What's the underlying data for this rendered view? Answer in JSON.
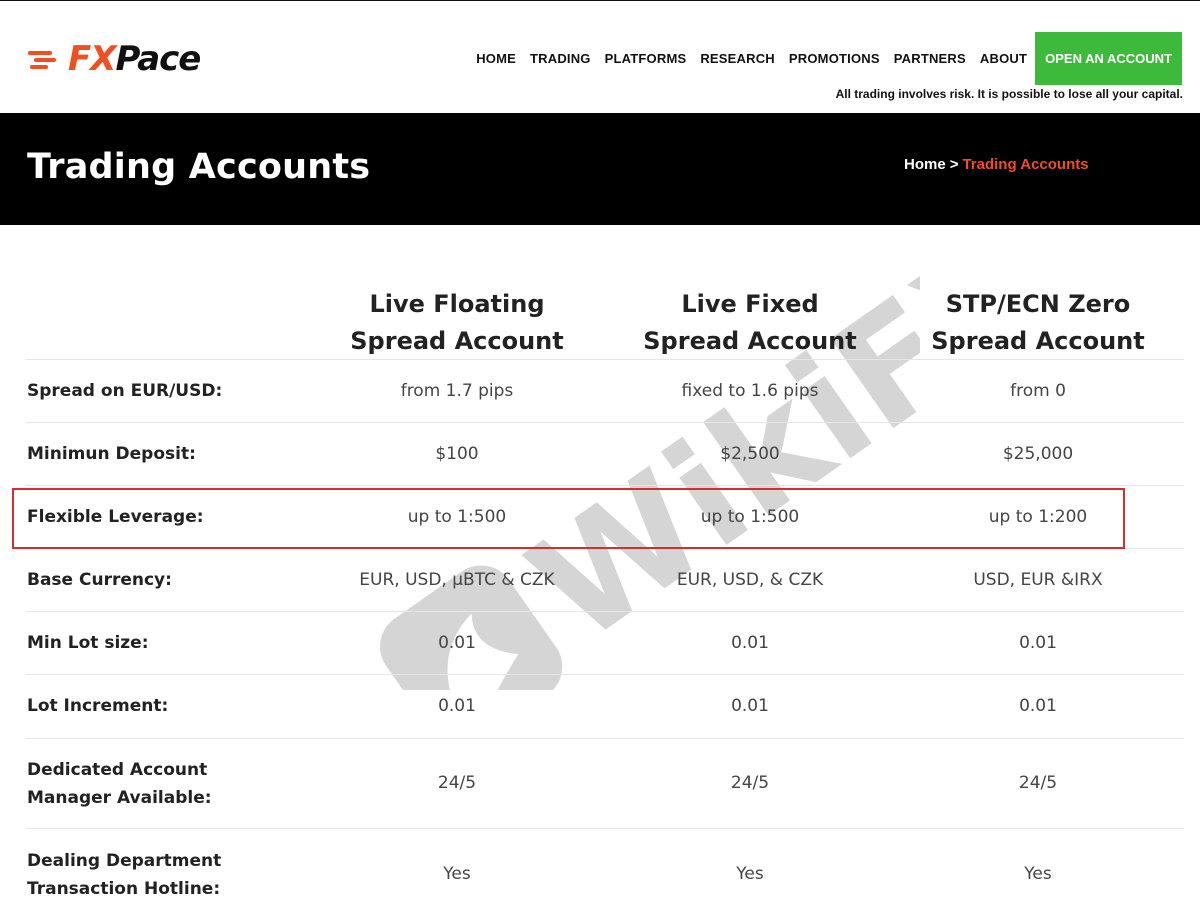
{
  "brand": {
    "logo_fx": "FX",
    "logo_pace": "Pace",
    "accent": "#f04e23",
    "cta_color": "#3dba3b"
  },
  "nav": {
    "items": [
      "HOME",
      "TRADING",
      "PLATFORMS",
      "RESEARCH",
      "PROMOTIONS",
      "PARTNERS",
      "ABOUT"
    ],
    "cta": "OPEN AN ACCOUNT",
    "risk_notice": "All trading involves risk. It is possible to lose all your capital."
  },
  "page": {
    "title": "Trading Accounts",
    "breadcrumb_home": "Home",
    "breadcrumb_sep": ">",
    "breadcrumb_current": "Trading Accounts"
  },
  "table": {
    "columns": [
      [
        "Live Floating",
        "Spread Account"
      ],
      [
        "Live Fixed",
        "Spread Account"
      ],
      [
        "STP/ECN Zero",
        "Spread Account"
      ]
    ],
    "rows": [
      {
        "label": [
          "Spread on EUR/USD:"
        ],
        "values": [
          "from 1.7 pips",
          "fixed to 1.6 pips",
          "from 0"
        ]
      },
      {
        "label": [
          "Minimun Deposit:"
        ],
        "values": [
          "$100",
          "$2,500",
          "$25,000"
        ]
      },
      {
        "label": [
          "Flexible Leverage:"
        ],
        "values": [
          "up to 1:500",
          "up to 1:500",
          "up to 1:200"
        ]
      },
      {
        "label": [
          "Base Currency:"
        ],
        "values": [
          "EUR, USD, µBTC & CZK",
          "EUR, USD, & CZK",
          "USD, EUR &IRX"
        ]
      },
      {
        "label": [
          "Min Lot size:"
        ],
        "values": [
          "0.01",
          "0.01",
          "0.01"
        ]
      },
      {
        "label": [
          "Lot Increment:"
        ],
        "values": [
          "0.01",
          "0.01",
          "0.01"
        ]
      },
      {
        "label": [
          "Dedicated Account",
          "Manager Available:"
        ],
        "values": [
          "24/5",
          "24/5",
          "24/5"
        ]
      },
      {
        "label": [
          "Dealing Department",
          "Transaction Hotline:"
        ],
        "values": [
          "Yes",
          "Yes",
          "Yes"
        ]
      }
    ]
  },
  "watermark": {
    "text": "WikiFX"
  }
}
